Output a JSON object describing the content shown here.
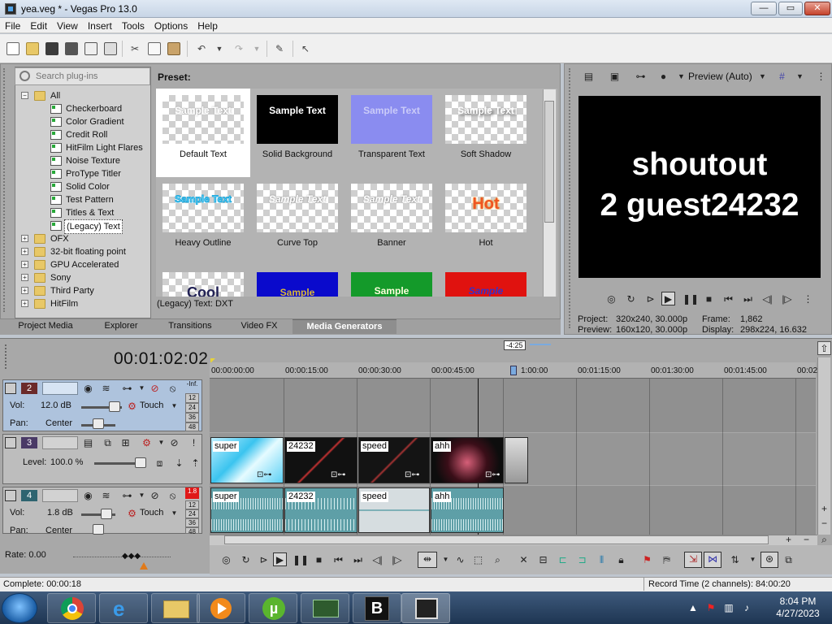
{
  "window": {
    "title": "yea.veg * - Vegas Pro 13.0",
    "controls": {
      "minimize": "—",
      "maximize": "▭",
      "close": "✕"
    }
  },
  "menu": [
    "File",
    "Edit",
    "View",
    "Insert",
    "Tools",
    "Options",
    "Help"
  ],
  "plugin_browser": {
    "search_placeholder": "Search plug-ins",
    "tree": [
      {
        "label": "All",
        "type": "folder",
        "expander": "−"
      },
      {
        "label": "Checkerboard",
        "type": "plugin"
      },
      {
        "label": "Color Gradient",
        "type": "plugin"
      },
      {
        "label": "Credit Roll",
        "type": "plugin"
      },
      {
        "label": "HitFilm Light Flares",
        "type": "plugin"
      },
      {
        "label": "Noise Texture",
        "type": "plugin"
      },
      {
        "label": "ProType Titler",
        "type": "plugin"
      },
      {
        "label": "Solid Color",
        "type": "plugin"
      },
      {
        "label": "Test Pattern",
        "type": "plugin"
      },
      {
        "label": "Titles & Text",
        "type": "plugin"
      },
      {
        "label": "(Legacy) Text",
        "type": "plugin",
        "selected": true
      },
      {
        "label": "OFX",
        "type": "folder",
        "expander": "+"
      },
      {
        "label": "32-bit floating point",
        "type": "folder",
        "expander": "+"
      },
      {
        "label": "GPU Accelerated",
        "type": "folder",
        "expander": "+"
      },
      {
        "label": "Sony",
        "type": "folder",
        "expander": "+"
      },
      {
        "label": "Third Party",
        "type": "folder",
        "expander": "+"
      },
      {
        "label": "HitFilm",
        "type": "folder",
        "expander": "+"
      }
    ]
  },
  "presets": {
    "header": "Preset:",
    "status": "(Legacy) Text: DXT",
    "items": [
      {
        "name": "Default Text",
        "thumb_text": "Sample Text",
        "selected": true
      },
      {
        "name": "Solid Background",
        "thumb_text": "Sample Text"
      },
      {
        "name": "Transparent Text",
        "thumb_text": "Sample Text"
      },
      {
        "name": "Soft Shadow",
        "thumb_text": "Sample Text"
      },
      {
        "name": "Heavy Outline",
        "thumb_text": "Sample Text"
      },
      {
        "name": "Curve Top",
        "thumb_text": "Sample Text"
      },
      {
        "name": "Banner",
        "thumb_text": "Sample Text"
      },
      {
        "name": "Hot",
        "thumb_text": "Hot"
      },
      {
        "name": "",
        "thumb_text": "Cool"
      },
      {
        "name": "",
        "thumb_text": "Sample"
      },
      {
        "name": "",
        "thumb_text": "Sample"
      },
      {
        "name": "",
        "thumb_text": "Sample"
      }
    ]
  },
  "tabs": [
    "Project Media",
    "Explorer",
    "Transitions",
    "Video FX",
    "Media Generators"
  ],
  "active_tab": "Media Generators",
  "preview": {
    "mode": "Preview (Auto)",
    "screen_text_line1": "shoutout",
    "screen_text_line2": "2 guest24232",
    "project_label": "Project:",
    "project_value": "320x240, 30.000p",
    "preview_label": "Preview:",
    "preview_value": "160x120, 30.000p",
    "frame_label": "Frame:",
    "frame_value": "1,862",
    "display_label": "Display:",
    "display_value": "298x224, 16.632"
  },
  "timeline": {
    "time_display": "00:01:02:02",
    "marker_label": "-4:25",
    "ruler_labels": [
      "00:00:00:00",
      "00:00:15:00",
      "00:00:30:00",
      "00:00:45:00",
      "1:00:00",
      "00:01:15:00",
      "00:01:30:00",
      "00:01:45:00",
      "00:02"
    ],
    "tracks": [
      {
        "number": "2",
        "kind": "audio",
        "vol_label": "Vol:",
        "vol_value": "12.0 dB",
        "pan_label": "Pan:",
        "pan_value": "Center",
        "mode": "Touch",
        "meter_top": "-Inf.",
        "meter_ticks": [
          "12",
          "24",
          "36",
          "48"
        ]
      },
      {
        "number": "3",
        "kind": "video",
        "level_label": "Level:",
        "level_value": "100.0 %"
      },
      {
        "number": "4",
        "kind": "audio",
        "vol_label": "Vol:",
        "vol_value": "1.8 dB",
        "pan_label": "Pan:",
        "pan_value": "Center",
        "mode": "Touch",
        "meter_top": "1.8",
        "meter_ticks": [
          "12",
          "24",
          "36",
          "48"
        ]
      }
    ],
    "video_clips": [
      "super",
      "24232",
      "speed",
      "ahh"
    ],
    "audio_clips": [
      "super",
      "24232",
      "speed",
      "ahh"
    ],
    "rate_label": "Rate: 0.00"
  },
  "status": {
    "left": "Complete: 00:00:18",
    "right": "Record Time (2 channels): 84:00:20"
  },
  "taskbar": {
    "time": "8:04 PM",
    "date": "4/27/2023"
  }
}
